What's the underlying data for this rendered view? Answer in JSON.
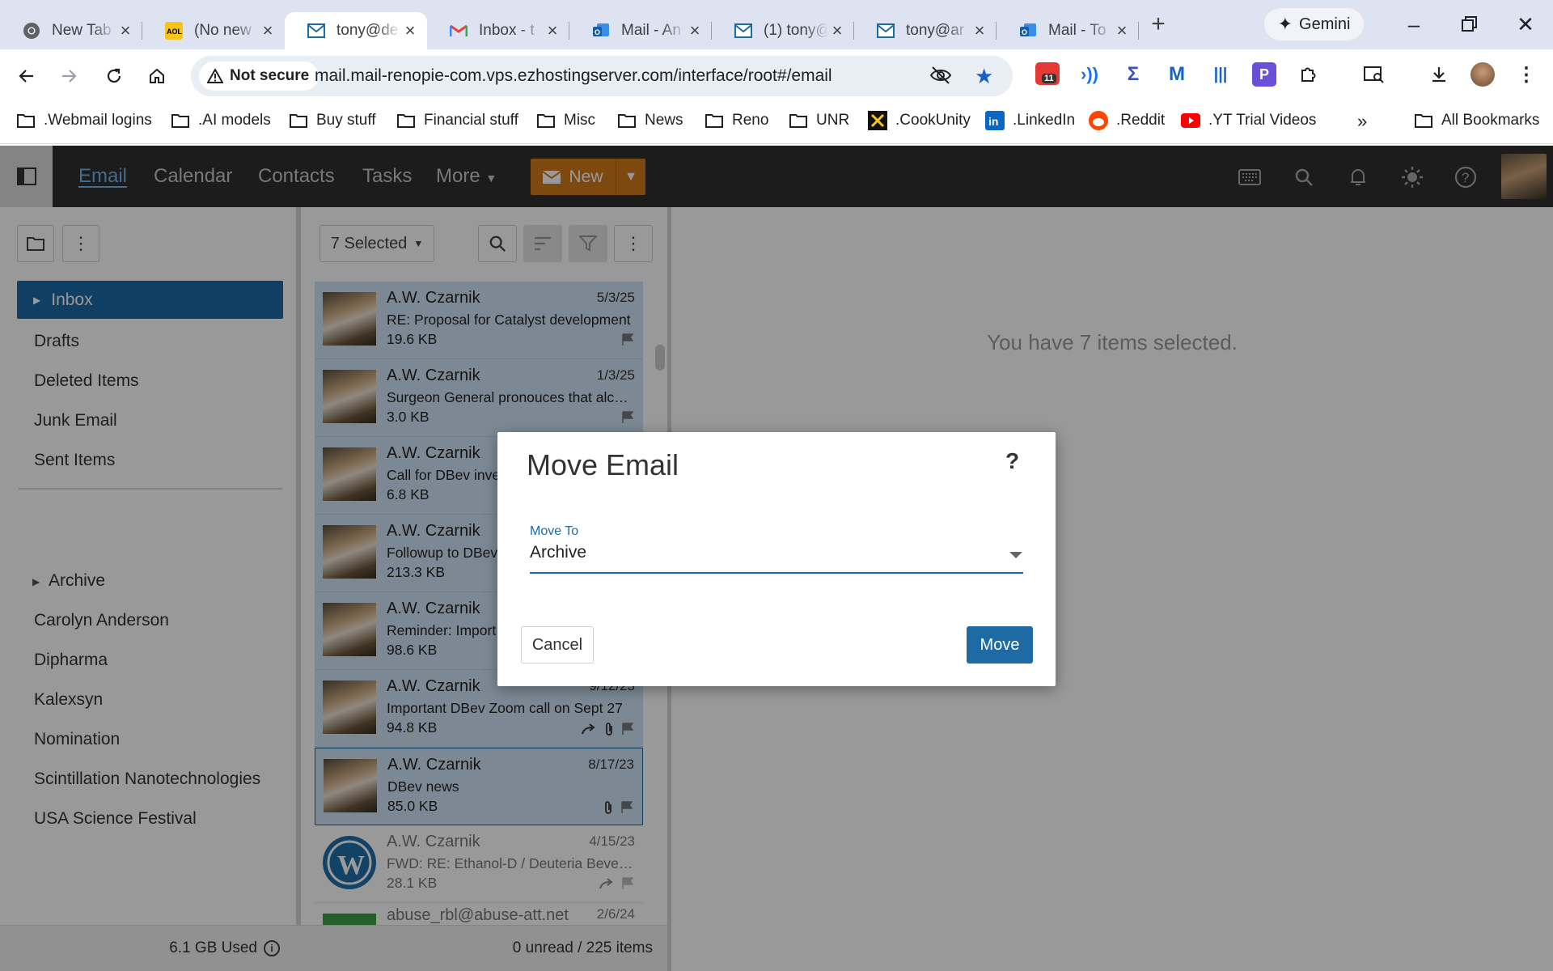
{
  "browser": {
    "tabs": [
      {
        "title": "New Tab",
        "icon": "chrome-icon"
      },
      {
        "title": "(No new",
        "icon": "aol-icon"
      },
      {
        "title": "tony@de",
        "icon": "mail-envelope-icon",
        "active": true
      },
      {
        "title": "Inbox - t",
        "icon": "gmail-icon"
      },
      {
        "title": "Mail - An",
        "icon": "outlook-icon"
      },
      {
        "title": "(1) tony@",
        "icon": "mail-envelope-icon"
      },
      {
        "title": "tony@ar",
        "icon": "mail-envelope-icon"
      },
      {
        "title": "Mail - To",
        "icon": "outlook-icon"
      }
    ],
    "gemini_label": "Gemini",
    "security_label": "Not secure",
    "url": "mail.mail-renopie-com.vps.ezhostingserver.com/interface/root#/email",
    "extension_badge": "11",
    "bookmarks": [
      ".Webmail logins",
      ".AI models",
      "Buy stuff",
      "Financial stuff",
      "Misc",
      "News",
      "Reno",
      "UNR",
      ".CookUnity",
      ".LinkedIn",
      ".Reddit",
      ".YT Trial Videos"
    ],
    "all_bookmarks": "All Bookmarks"
  },
  "app": {
    "nav": [
      "Email",
      "Calendar",
      "Contacts",
      "Tasks"
    ],
    "more_label": "More",
    "new_label": "New",
    "folders": {
      "inbox": "Inbox",
      "system": [
        "Drafts",
        "Deleted Items",
        "Junk Email",
        "Sent Items"
      ],
      "archive": "Archive",
      "custom": [
        "Carolyn Anderson",
        "Dipharma",
        "Kalexsyn",
        "Nomination",
        "Scintillation Nanotechnologies",
        "USA Science Festival"
      ]
    },
    "storage": "6.1 GB Used",
    "selected_label": "7 Selected",
    "messages": [
      {
        "from": "A.W. Czarnik",
        "date": "5/3/25",
        "subject": "RE: Proposal for Catalyst development",
        "size": "19.6 KB"
      },
      {
        "from": "A.W. Czarnik",
        "date": "1/3/25",
        "subject": "Surgeon General pronouces that alcohol",
        "size": "3.0 KB"
      },
      {
        "from": "A.W. Czarnik",
        "date": "",
        "subject": "Call for DBev inve",
        "size": "6.8 KB"
      },
      {
        "from": "A.W. Czarnik",
        "date": "",
        "subject": "Followup to DBev",
        "size": "213.3 KB"
      },
      {
        "from": "A.W. Czarnik",
        "date": "",
        "subject": "Reminder: Import",
        "size": "98.6 KB"
      },
      {
        "from": "A.W. Czarnik",
        "date": "9/12/23",
        "subject": "Important DBev Zoom call on Sept 27",
        "size": "94.8 KB"
      },
      {
        "from": "A.W. Czarnik",
        "date": "8/17/23",
        "subject": "DBev news",
        "size": "85.0 KB"
      },
      {
        "from": "A.W. Czarnik",
        "date": "4/15/23",
        "subject": "FWD: RE: Ethanol-D / Deuteria Beverages",
        "size": "28.1 KB"
      },
      {
        "from": "abuse_rbl@abuse-att.net",
        "date": "2/6/24",
        "subject": "",
        "size": ""
      }
    ],
    "list_footer": "0 unread / 225 items",
    "reading_message": "You have 7 items selected."
  },
  "dialog": {
    "title": "Move Email",
    "help": "?",
    "field_label": "Move To",
    "field_value": "Archive",
    "cancel": "Cancel",
    "confirm": "Move"
  }
}
